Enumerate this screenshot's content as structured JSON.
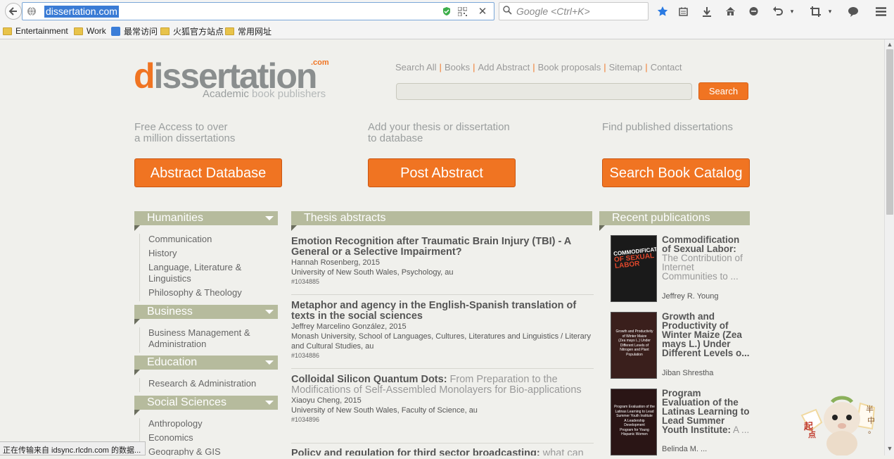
{
  "browser": {
    "url": "dissertation.com",
    "search_placeholder": "Google <Ctrl+K>",
    "bookmarks": [
      "Entertainment",
      "Work",
      "最常访问",
      "火狐官方站点",
      "常用网址"
    ],
    "status_text": "正在传输来自 idsync.rlcdn.com 的数据..."
  },
  "site": {
    "logo": {
      "main_prefix": "d",
      "main_rest": "issertation",
      "tld": ".com",
      "subtitle_1": "Academic",
      "subtitle_2": "book publishers"
    },
    "nav": [
      "Search All",
      "Books",
      "Add Abstract",
      "Book proposals",
      "Sitemap",
      "Contact"
    ],
    "search_button": "Search",
    "promos": [
      {
        "line1": "Free Access to over",
        "line2": "a million dissertations",
        "button": "Abstract Database"
      },
      {
        "line1": "Add your thesis or dissertation",
        "line2": "to database",
        "button": "Post Abstract"
      },
      {
        "line1": "Find published dissertations",
        "line2": "",
        "button": "Search Book Catalog"
      }
    ],
    "sidebar": [
      {
        "heading": "Humanities",
        "items": [
          "Communication",
          "History",
          "Language, Literature & Linguistics",
          "Philosophy & Theology"
        ]
      },
      {
        "heading": "Business",
        "items": [
          "Business Management & Administration"
        ]
      },
      {
        "heading": "Education",
        "items": [
          "Research & Administration"
        ]
      },
      {
        "heading": "Social Sciences",
        "items": [
          "Anthropology",
          "Economics",
          "Geography & GIS"
        ]
      }
    ],
    "abstracts_heading": "Thesis abstracts",
    "abstracts": [
      {
        "title": "Emotion Recognition after Traumatic Brain Injury (TBI) - A General or a Selective Impairment?",
        "title_dim": "",
        "author": "Hannah Rosenberg, 2015",
        "affiliation": "University of New South Wales, Psychology, au",
        "id": "#1034885"
      },
      {
        "title": "Metaphor and agency in the English-Spanish translation of texts in the social sciences",
        "title_dim": "",
        "author": "Jeffrey Marcelino González, 2015",
        "affiliation": "Monash University, School of Languages, Cultures, Literatures and Linguistics / Literary and Cultural Studies, au",
        "id": "#1034886"
      },
      {
        "title": "Colloidal Silicon Quantum Dots:",
        "title_dim": " From Preparation to the Modifications of Self-Assembled Monolayers for Bio-applications",
        "author": "Xiaoyu Cheng, 2015",
        "affiliation": "University of New South Wales, Faculty of Science, au",
        "id": "#1034896"
      },
      {
        "title": "Policy and regulation for third sector broadcasting:",
        "title_dim": " what can",
        "author": "",
        "affiliation": "",
        "id": ""
      }
    ],
    "recent_heading": "Recent publications",
    "recent": [
      {
        "title": "Commodification of Sexual Labor:",
        "title_dim": " The Contribution of Internet Communities to ...",
        "author": "Jeffrey R. Young",
        "cover_lines": [
          "COMMODIFICATION",
          "OF SEXUAL",
          "LABOR"
        ]
      },
      {
        "title": "Growth and Productivity of Winter Maize (Zea mays L.) Under Different Levels o...",
        "title_dim": "",
        "author": "Jiban Shrestha",
        "cover_lines": [
          "Growth and Productivity",
          "of Winter Maize",
          "(Zea mays L.) Under",
          "Different Levels of",
          "Nitrogen and Plant",
          "Population"
        ]
      },
      {
        "title": "Program Evaluation of the Latinas Learning to Lead Summer Youth Institute:",
        "title_dim": " A ...",
        "author": "Belinda M. ...",
        "cover_lines": [
          "Program Evaluation of the",
          "Latinas Learning to Lead",
          "Summer Youth Institute",
          "A Leadership Development",
          "Program for Young",
          "Hispanic Women"
        ]
      }
    ],
    "mascot_text": [
      "起",
      "点",
      "半",
      "中",
      "。"
    ]
  },
  "colors": {
    "accent": "#f07422",
    "bar": "#b6bb9d",
    "url_highlight": "#3a7bd5"
  }
}
